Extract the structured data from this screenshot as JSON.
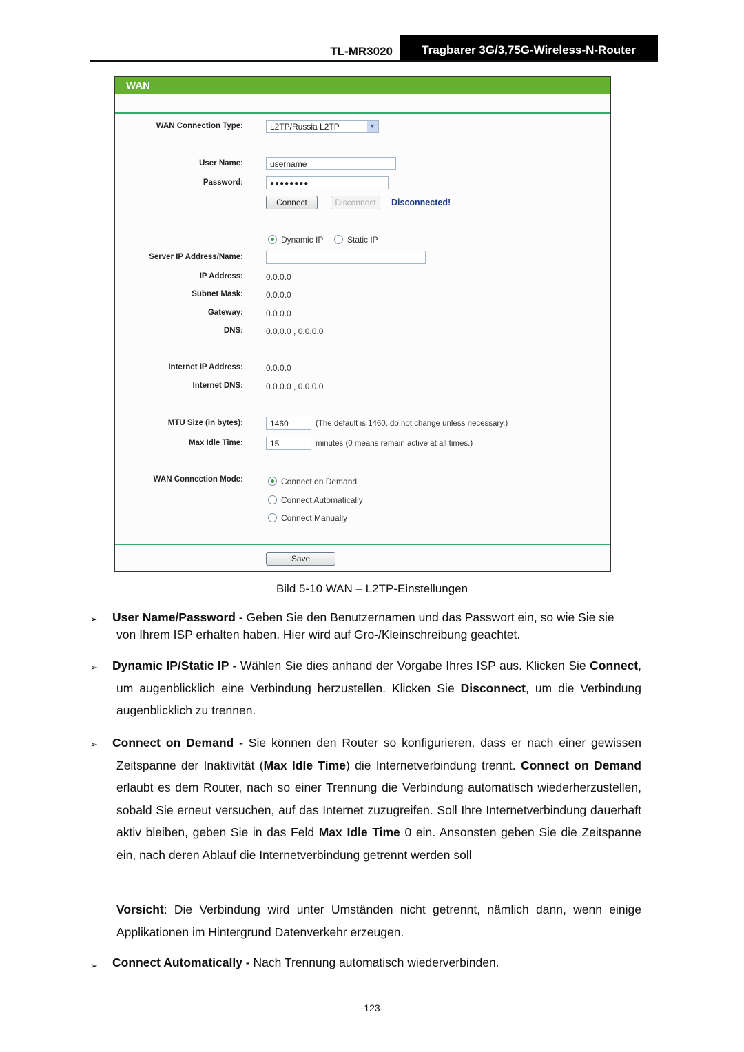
{
  "header": {
    "model": "TL-MR3020",
    "title": "Tragbarer 3G/3,75G-Wireless-N-Router"
  },
  "screenshot": {
    "section_title": "WAN",
    "accent_color": "#66b032",
    "wan_connection_type": {
      "label": "WAN Connection Type:",
      "value": "L2TP/Russia L2TP"
    },
    "user_name": {
      "label": "User Name:",
      "value": "username"
    },
    "password": {
      "label": "Password:",
      "value": "●●●●●●●●"
    },
    "connect_button": "Connect",
    "disconnect_button": "Disconnect",
    "status": "Disconnected!",
    "ip_mode": {
      "options": [
        "Dynamic IP",
        "Static IP"
      ],
      "selected": "Dynamic IP"
    },
    "server_ip": {
      "label": "Server IP Address/Name:",
      "value": ""
    },
    "ip_address": {
      "label": "IP Address:",
      "value": "0.0.0.0"
    },
    "subnet_mask": {
      "label": "Subnet Mask:",
      "value": "0.0.0.0"
    },
    "gateway": {
      "label": "Gateway:",
      "value": "0.0.0.0"
    },
    "dns": {
      "label": "DNS:",
      "value": "0.0.0.0 , 0.0.0.0"
    },
    "internet_ip": {
      "label": "Internet IP Address:",
      "value": "0.0.0.0"
    },
    "internet_dns": {
      "label": "Internet DNS:",
      "value": "0.0.0.0 , 0.0.0.0"
    },
    "mtu": {
      "label": "MTU Size (in bytes):",
      "value": "1460",
      "hint": "(The default is 1460, do not change unless necessary.)"
    },
    "max_idle": {
      "label": "Max Idle Time:",
      "value": "15",
      "hint": "minutes (0 means remain active at all times.)"
    },
    "connection_mode": {
      "label": "WAN Connection Mode:",
      "options": [
        "Connect on Demand",
        "Connect Automatically",
        "Connect Manually"
      ],
      "selected": "Connect on Demand"
    },
    "save_button": "Save"
  },
  "caption": "Bild 5-10 WAN – L2TP-Einstellungen",
  "bullets": {
    "b1": {
      "bold": "User Name/Password -",
      "text": " Geben Sie den Benutzernamen und das Passwort ein, so wie Sie sie",
      "line2": "von Ihrem ISP erhalten haben. Hier wird auf Gro-/Kleinschreibung geachtet."
    },
    "b2": {
      "bold": "Dynamic IP/Static IP -",
      "t1": " Wählen Sie dies anhand der Vorgabe Ihres ISP aus. Klicken Sie ",
      "b_connect": "Connect",
      "t2": ", um augenblicklich eine Verbindung herzustellen. Klicken Sie ",
      "b_disconnect": "Disconnect",
      "t3": ", um die Verbindung augenblicklich zu trennen."
    },
    "b3": {
      "bold": "Connect on Demand -",
      "t1": " Sie können den Router so konfigurieren, dass er nach einer gewissen Zeitspanne der Inaktivität (",
      "b_idle": "Max Idle Time",
      "t2": ") die Internetverbindung trennt. ",
      "b_cod": "Connect on Demand",
      "t3": " erlaubt es dem Router, nach so einer Trennung die Verbindung automatisch wiederherzustellen, sobald Sie erneut versuchen, auf das Internet zuzugreifen. Soll Ihre Internetverbindung dauerhaft aktiv bleiben, geben Sie in das Feld ",
      "b_idle2": "Max Idle Time",
      "t4": " 0 ein. Ansonsten geben Sie die Zeitspanne ein, nach deren Ablauf die Internetverbindung getrennt werden soll"
    },
    "note": {
      "bold": "Vorsicht",
      "text": ": Die Verbindung wird unter Umständen nicht getrennt, nämlich dann, wenn einige Applikationen im Hintergrund Datenverkehr erzeugen."
    },
    "b4": {
      "bold": "Connect Automatically -",
      "text": " Nach Trennung automatisch wiederverbinden."
    }
  },
  "bullet_glyph": "➢",
  "page_number": "-123-"
}
